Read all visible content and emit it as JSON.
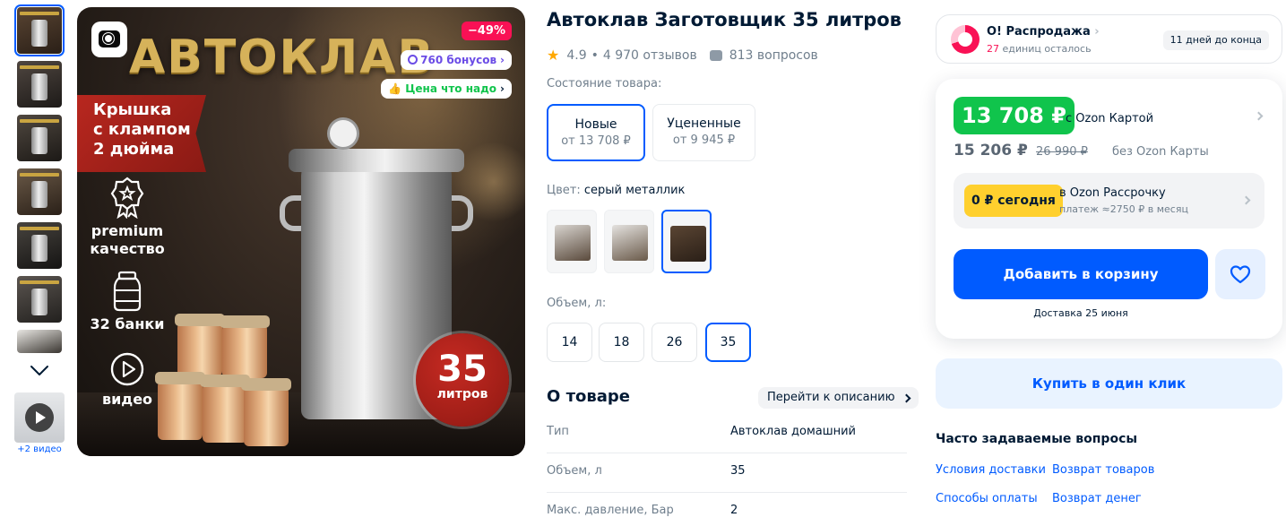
{
  "gallery": {
    "thumbnails": [
      {
        "name": "thumb-1",
        "colors": [
          "#3a2d22",
          "#6a5443"
        ]
      },
      {
        "name": "thumb-2",
        "colors": [
          "#2a2623",
          "#4f4640"
        ]
      },
      {
        "name": "thumb-3",
        "colors": [
          "#26221f",
          "#504840"
        ]
      },
      {
        "name": "thumb-4",
        "colors": [
          "#312822",
          "#6b5a48"
        ]
      },
      {
        "name": "thumb-5",
        "colors": [
          "#1f1e1d",
          "#48443f"
        ]
      },
      {
        "name": "thumb-6",
        "colors": [
          "#2d2a28",
          "#5b5550"
        ]
      },
      {
        "name": "thumb-7",
        "colors": [
          "#3a3631",
          "#e8e6e2"
        ]
      }
    ],
    "video_caption": "+2 видео"
  },
  "main_image": {
    "heading": "АВТОКЛАВ",
    "discount": "−49%",
    "bonus": "760 бонусов",
    "price_tag": "Цена что надо",
    "ribbon_lines": [
      "Крышка",
      "с клампом",
      "2 дюйма"
    ],
    "features": [
      {
        "label": "premium качество",
        "icon": "medal-icon"
      },
      {
        "label": "32 банки",
        "icon": "jar-icon"
      },
      {
        "label": "видео",
        "icon": "play-icon"
      }
    ],
    "badge_number": "35",
    "badge_text": "литров"
  },
  "product": {
    "title": "Автоклав Заготовщик 35 литров",
    "rating": "4.9",
    "reviews": "4 970 отзывов",
    "questions": "813 вопросов",
    "condition_label": "Состояние товара:",
    "conditions": [
      {
        "title": "Новые",
        "price": "от 13 708 ₽",
        "selected": true
      },
      {
        "title": "Уцененные",
        "price": "от 9 945 ₽",
        "selected": false
      }
    ],
    "color_label": "Цвет:",
    "color_value": "серый металлик",
    "volume_label": "Объем, л:",
    "volumes": [
      "14",
      "18",
      "26",
      "35"
    ],
    "selected_volume": "35"
  },
  "about": {
    "title": "О товаре",
    "to_description": "Перейти к описанию",
    "specs": [
      {
        "key": "Тип",
        "value": "Автоклав домашний"
      },
      {
        "key": "Объем, л",
        "value": "35"
      },
      {
        "key": "Макс. давление, Бар",
        "value": "2"
      }
    ]
  },
  "sale": {
    "title": "О! Распродажа",
    "units_count": "27",
    "units_text": "единиц осталось",
    "days_left": "11 дней до конца"
  },
  "pricing": {
    "card_price": "13 708 ₽",
    "card_label": "с Ozon Картой",
    "regular_price": "15 206 ₽",
    "old_price": "26 990 ₽",
    "regular_label": "без Ozon Карты",
    "installment_pill": "0 ₽ сегодня",
    "installment_title": "в Ozon Рассрочку",
    "installment_sub": "платеж ≈2750 ₽ в месяц",
    "add_to_cart": "Добавить в корзину",
    "delivery": "Доставка 25 июня",
    "one_click": "Купить в один клик"
  },
  "faq": {
    "title": "Часто задаваемые вопросы",
    "links": [
      "Условия доставки",
      "Возврат товаров",
      "Способы оплаты",
      "Возврат денег"
    ]
  },
  "colors": {
    "accent": "#005bff",
    "green": "#10c44c",
    "pink": "#f91155",
    "yellow": "#ffd02e"
  }
}
